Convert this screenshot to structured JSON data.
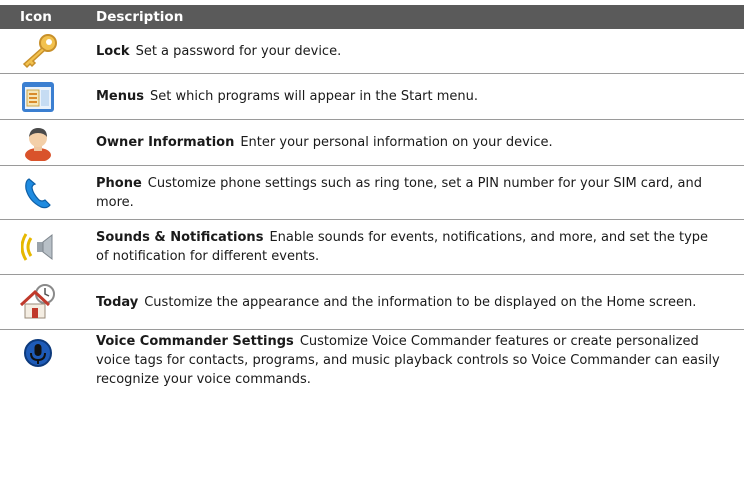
{
  "header": {
    "icon": "Icon",
    "description": "Description"
  },
  "rows": [
    {
      "icon": "key-icon",
      "term": "Lock",
      "text": "Set a password for your device."
    },
    {
      "icon": "menus-icon",
      "term": "Menus",
      "text": "Set which programs will appear in the Start menu."
    },
    {
      "icon": "person-icon",
      "term": "Owner Information",
      "text": "Enter your personal information on your device."
    },
    {
      "icon": "phone-icon",
      "term": "Phone",
      "text": "Customize phone settings such as ring tone, set a PIN number for your SIM card, and more."
    },
    {
      "icon": "speaker-icon",
      "term": "Sounds & Notifications",
      "text": "Enable sounds for events, notifications, and more, and set the type of notification for different events."
    },
    {
      "icon": "home-clock-icon",
      "term": "Today",
      "text": "Customize the appearance and the information to be displayed on the Home screen."
    },
    {
      "icon": "microphone-icon",
      "term": "Voice Commander Settings",
      "text": "Customize Voice Commander features or create personalized voice tags for contacts, programs, and music playback controls so Voice Commander can easily recognize your voice commands."
    }
  ]
}
